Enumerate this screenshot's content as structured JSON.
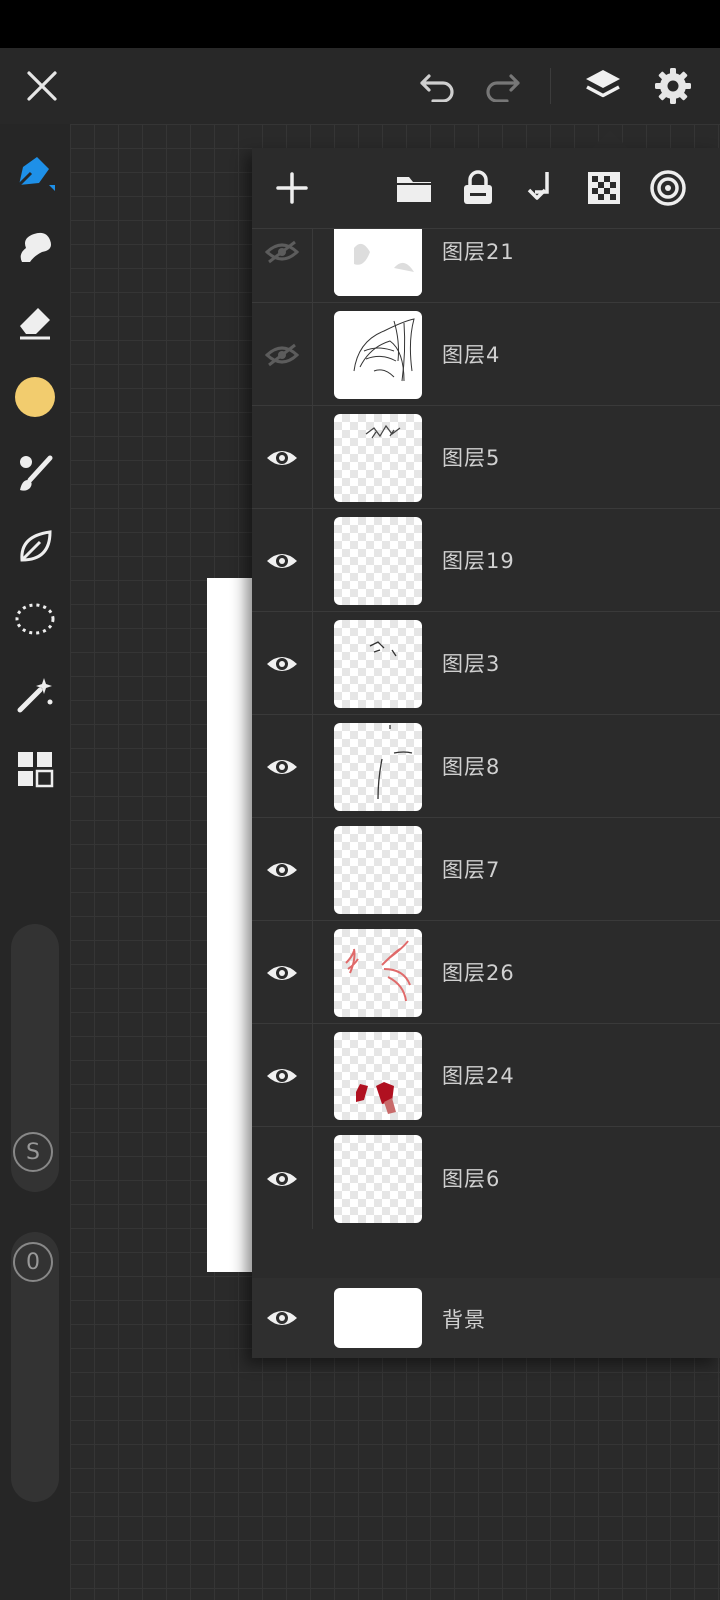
{
  "topbar": {
    "close_icon": "close-icon",
    "undo_icon": "undo-icon",
    "redo_icon": "redo-icon",
    "layers_icon": "layers-icon",
    "settings_icon": "gear-icon"
  },
  "toolbar": {
    "tools": [
      "pen-tool",
      "smudge-tool",
      "eraser-tool",
      "color-swatch",
      "brush-tool",
      "leaf-shape-tool",
      "lasso-selection-tool",
      "magic-wand-tool",
      "grid-tool"
    ],
    "active_color": "#f2cc6e",
    "accent_color": "#1e90e8",
    "size_slider_badge": "S",
    "opacity_slider_badge": "0"
  },
  "layers_panel": {
    "actions": [
      "add-layer",
      "folder",
      "lock",
      "merge-down",
      "transparency",
      "blend"
    ],
    "layers": [
      {
        "name": "图层21",
        "visible": false
      },
      {
        "name": "图层4",
        "visible": false
      },
      {
        "name": "图层5",
        "visible": true
      },
      {
        "name": "图层19",
        "visible": true
      },
      {
        "name": "图层3",
        "visible": true
      },
      {
        "name": "图层8",
        "visible": true
      },
      {
        "name": "图层7",
        "visible": true
      },
      {
        "name": "图层26",
        "visible": true
      },
      {
        "name": "图层24",
        "visible": true
      },
      {
        "name": "图层6",
        "visible": true
      },
      {
        "name": "",
        "visible": true
      }
    ],
    "background_layer": {
      "name": "背景",
      "visible": true
    }
  }
}
